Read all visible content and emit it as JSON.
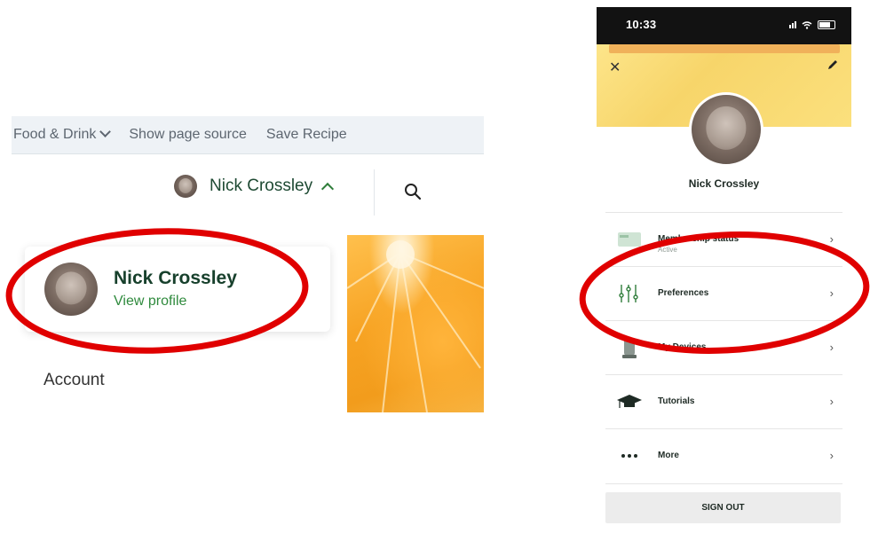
{
  "web": {
    "nav": {
      "food_drink": "Food & Drink",
      "show_source": "Show page source",
      "save_recipe": "Save Recipe"
    },
    "user_menu": {
      "name": "Nick Crossley"
    },
    "profile_card": {
      "name": "Nick Crossley",
      "link": "View profile"
    },
    "account_label": "Account"
  },
  "phone": {
    "status_bar": {
      "time": "10:33"
    },
    "profile_name": "Nick Crossley",
    "menu": [
      {
        "label": "Membership status",
        "sub": "Active"
      },
      {
        "label": "Preferences"
      },
      {
        "label": "My Devices"
      },
      {
        "label": "Tutorials"
      },
      {
        "label": "More"
      }
    ],
    "sign_out": "SIGN OUT"
  },
  "colors": {
    "brand_green": "#2f8a3d",
    "dark_green": "#17402c",
    "annotation_red": "#e00000",
    "header_yellow": "#f7d56a"
  }
}
